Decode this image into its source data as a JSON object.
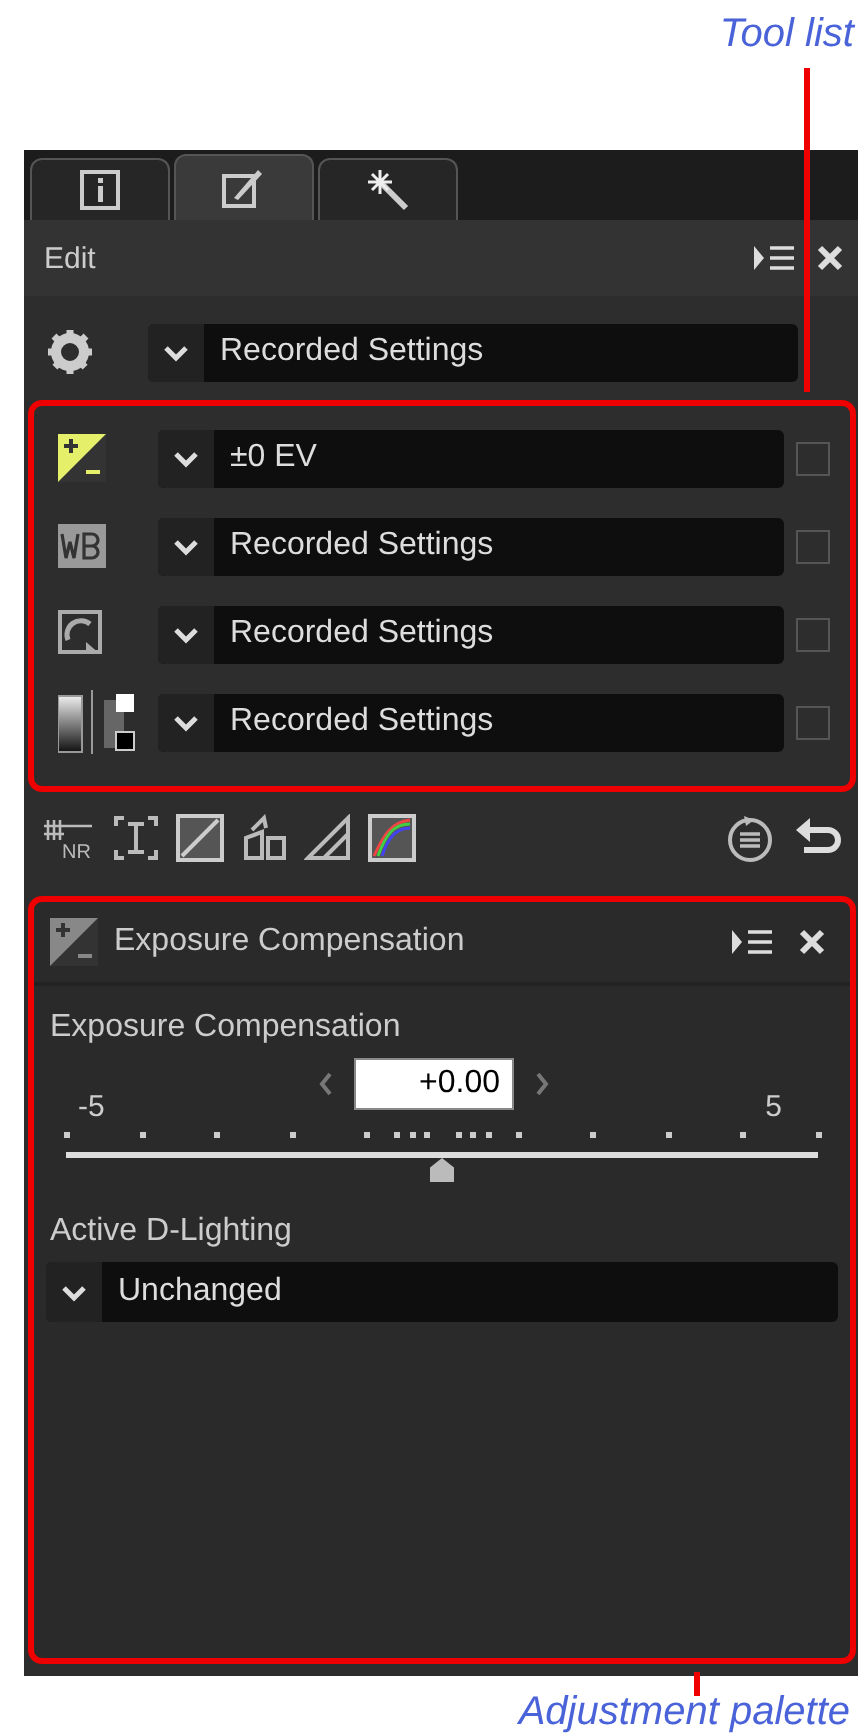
{
  "tool_list_callout": "Tool list",
  "tabs": [
    {
      "kind": "info",
      "selected": false
    },
    {
      "kind": "edit",
      "selected": true
    },
    {
      "kind": "effects",
      "selected": false
    }
  ],
  "edit": {
    "title": "Edit",
    "settings_value": "Recorded Settings"
  },
  "tools": [
    {
      "kind": "exposure",
      "value": "±0 EV",
      "selected": true,
      "checked": false
    },
    {
      "kind": "white-balance",
      "value": "Recorded Settings",
      "selected": false,
      "checked": false
    },
    {
      "kind": "picture-control",
      "value": "Recorded Settings",
      "selected": false,
      "checked": false
    },
    {
      "kind": "d-lighting",
      "value": "Recorded Settings",
      "selected": false,
      "checked": false
    }
  ],
  "toolbar": {
    "noise_reduction_label": "NR"
  },
  "palette": {
    "title": "Exposure Compensation",
    "slider_label": "Exposure Compensation",
    "value": "+0.00",
    "min_label": "-5",
    "max_label": "5",
    "level": 0.5,
    "adl_label": "Active D-Lighting",
    "adl_value": "Unchanged"
  },
  "palette_callout": "Adjustment palette"
}
